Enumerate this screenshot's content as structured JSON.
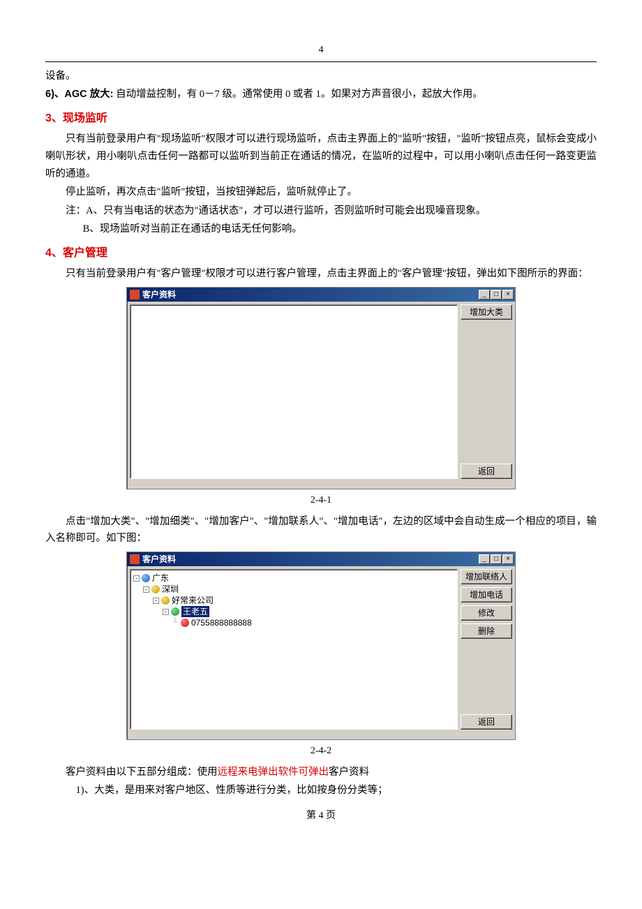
{
  "pageHeader": "4",
  "para_device": "设备。",
  "item6_label": "6)、AGC 放大:",
  "item6_text": " 自动增益控制，有 0－7 级。通常使用 0 或者 1。如果对方声音很小，起放大作用。",
  "heading3": "3、现场监听",
  "sec3_p1": "只有当前登录用户有\"现场监听\"权限才可以进行现场监听，点击主界面上的\"监听\"按钮，\"监听\"按钮点亮，鼠标会变成小喇叭形状，用小喇叭点击任何一路都可以监听到当前正在通话的情况，在监听的过程中，可以用小喇叭点击任何一路变更监听的通道。",
  "sec3_p2": "停止监听，再次点击\"监听\"按钮，当按钮弹起后，监听就停止了。",
  "sec3_note_a": "注：A、只有当电话的状态为\"通话状态\"，才可以进行监听，否则监听时可能会出现噪音现象。",
  "sec3_note_b": "B、现场监听对当前正在通话的电话无任何影响。",
  "heading4": "4、客户管理",
  "sec4_p1": "只有当前登录用户有\"客户管理\"权限才可以进行客户管理，点击主界面上的\"客户管理\"按钮，弹出如下图所示的界面：",
  "dialog1": {
    "title": "客户资料",
    "btn_add_category": "增加大类",
    "btn_return": "返回"
  },
  "caption1": "2-4-1",
  "sec4_p2": "点击\"增加大类\"、\"增加细类\"、\"增加客户\"、\"增加联系人\"、\"增加电话\"，左边的区域中会自动生成一个相应的项目，输入名称即可。如下图：",
  "dialog2": {
    "title": "客户资料",
    "tree": {
      "n1": "广东",
      "n2": "深圳",
      "n3": "好常来公司",
      "n4": "王老五",
      "n5": "0755888888888"
    },
    "btn_add_contact": "增加联络人",
    "btn_add_phone": "增加电话",
    "btn_modify": "修改",
    "btn_delete": "删除",
    "btn_return": "返回"
  },
  "caption2": "2-4-2",
  "sec4_p3_a": "客户资料由以下五部分组成：使用",
  "sec4_p3_link": "远程来电弹出软件可弹出",
  "sec4_p3_b": "客户资料",
  "sec4_item1": "1)、大类，是用来对客户地区、性质等进行分类，比如按身份分类等；",
  "pageFooter": "第 4 页"
}
